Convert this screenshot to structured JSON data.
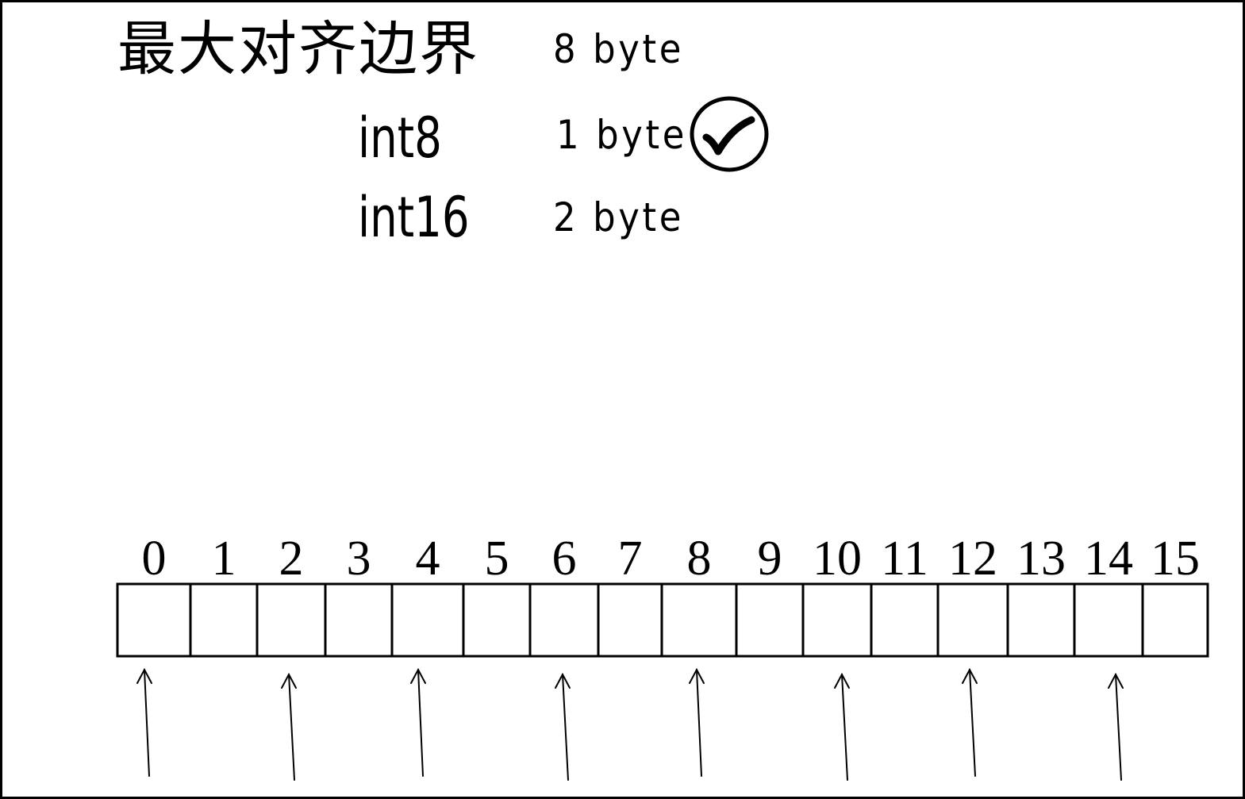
{
  "header": {
    "title": "最大对齐边界",
    "max_align_value": "8 byte"
  },
  "types": [
    {
      "name": "int8",
      "size": "1 byte",
      "checked": true
    },
    {
      "name": "int16",
      "size": "2 byte",
      "checked": false
    }
  ],
  "memory": {
    "indices": [
      "0",
      "1",
      "2",
      "3",
      "4",
      "5",
      "6",
      "7",
      "8",
      "9",
      "10",
      "11",
      "12",
      "13",
      "14",
      "15"
    ],
    "arrows_at": [
      0,
      2,
      4,
      6,
      8,
      10,
      12,
      14
    ]
  },
  "icons": {
    "check": "check-circle-icon"
  }
}
